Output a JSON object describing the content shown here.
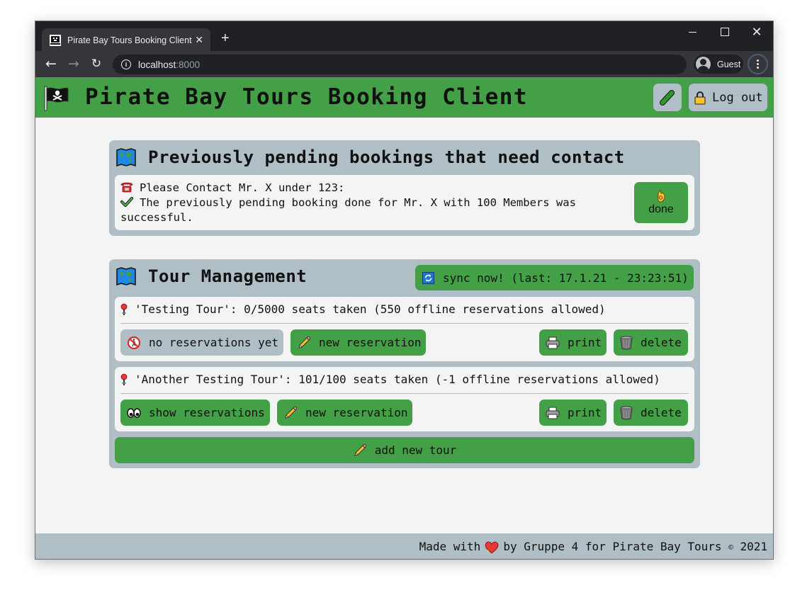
{
  "browser": {
    "tab_title": "Pirate Bay Tours Booking Client",
    "tab_close": "✕",
    "new_tab": "+",
    "url_host": "localhost",
    "url_port": ":8000",
    "profile_name": "Guest",
    "nav": {
      "back": "←",
      "forward": "→",
      "reload": "↻"
    },
    "window_close": "✕"
  },
  "header": {
    "title": "Pirate Bay Tours Booking Client",
    "logout_label": "Log out",
    "icons": {
      "logo": "pirate-flag-icon",
      "pickle": "pickle-icon",
      "lock": "lock-icon"
    }
  },
  "pending": {
    "heading": "Previously pending bookings that need contact",
    "heading_icon": "world-map-icon",
    "contact_line": "Please Contact Mr. X under 123:",
    "contact_icon": "telephone-icon",
    "result_line": "The previously pending booking done for Mr. X with 100 Members was successful.",
    "result_icon": "check-mark-icon",
    "done_label": "done",
    "done_icon": "ok-hand-icon"
  },
  "tours": {
    "heading": "Tour Management",
    "heading_icon": "world-map-icon",
    "sync_label": "sync now! (last: 17.1.21 - 23:23:51)",
    "sync_icon": "refresh-icon",
    "items": [
      {
        "summary": "'Testing Tour': 0/5000 seats taken (550 offline reservations allowed)",
        "name": "Testing Tour",
        "seats_taken": 0,
        "seats_total": 5000,
        "offline_allowed": 550,
        "reservations_label": "no reservations yet",
        "reservations_icon": "no-pedestrians-icon",
        "reservations_enabled": false,
        "new_reservation_label": "new reservation",
        "print_label": "print",
        "delete_label": "delete"
      },
      {
        "summary": "'Another Testing Tour': 101/100 seats taken (-1 offline reservations allowed)",
        "name": "Another Testing Tour",
        "seats_taken": 101,
        "seats_total": 100,
        "offline_allowed": -1,
        "reservations_label": "show reservations",
        "reservations_icon": "eyes-icon",
        "reservations_enabled": true,
        "new_reservation_label": "new reservation",
        "print_label": "print",
        "delete_label": "delete"
      }
    ],
    "add_tour_label": "add new tour"
  },
  "footer": {
    "made_with": "Made with",
    "by_text": "by Gruppe 4 for Pirate Bay Tours",
    "copyright_symbol": "©",
    "year": "2021"
  },
  "colors": {
    "primary_green": "#43a047",
    "panel_grey": "#b0bec5",
    "background": "#f4f4f4",
    "chrome_dark": "#202124",
    "chrome_toolbar": "#35363a"
  }
}
